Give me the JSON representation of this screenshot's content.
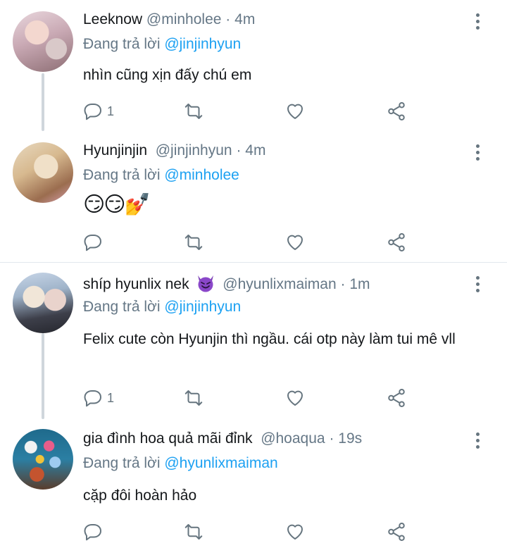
{
  "tweets": [
    {
      "name": "Leeknow",
      "handle": "@minholee",
      "time": "4m",
      "reply_prefix": "Đang trả lời",
      "reply_to": "@jinjinhyun",
      "text": "nhìn cũng xịn đấy chú em",
      "reply_count": "1"
    },
    {
      "name": "Hyunjinjin",
      "handle": "@jinjinhyun",
      "time": "4m",
      "reply_prefix": "Đang trả lời",
      "reply_to": "@minholee",
      "text": "😏😏💅",
      "reply_count": ""
    },
    {
      "name": "shíp hyunlix nek",
      "name_icon": "smiling-devil-emoji",
      "handle": "@hyunlixmaiman",
      "time": "1m",
      "reply_prefix": "Đang trả lời",
      "reply_to": "@jinjinhyun",
      "text": "Felix cute còn Hyunjin thì ngầu. cái otp này làm tui mê vll",
      "reply_count": "1"
    },
    {
      "name": "gia đình hoa quả mãi đỉnk",
      "handle": "@hoaqua",
      "time": "19s",
      "reply_prefix": "Đang trả lời",
      "reply_to": "@hyunlixmaiman",
      "text": "cặp đôi hoàn hảo",
      "reply_count": ""
    }
  ],
  "separator": "·",
  "colors": {
    "mention": "#1da1f2",
    "secondary_text": "#657786",
    "icon": "#66757f",
    "thread_line": "#cfd6dc"
  }
}
